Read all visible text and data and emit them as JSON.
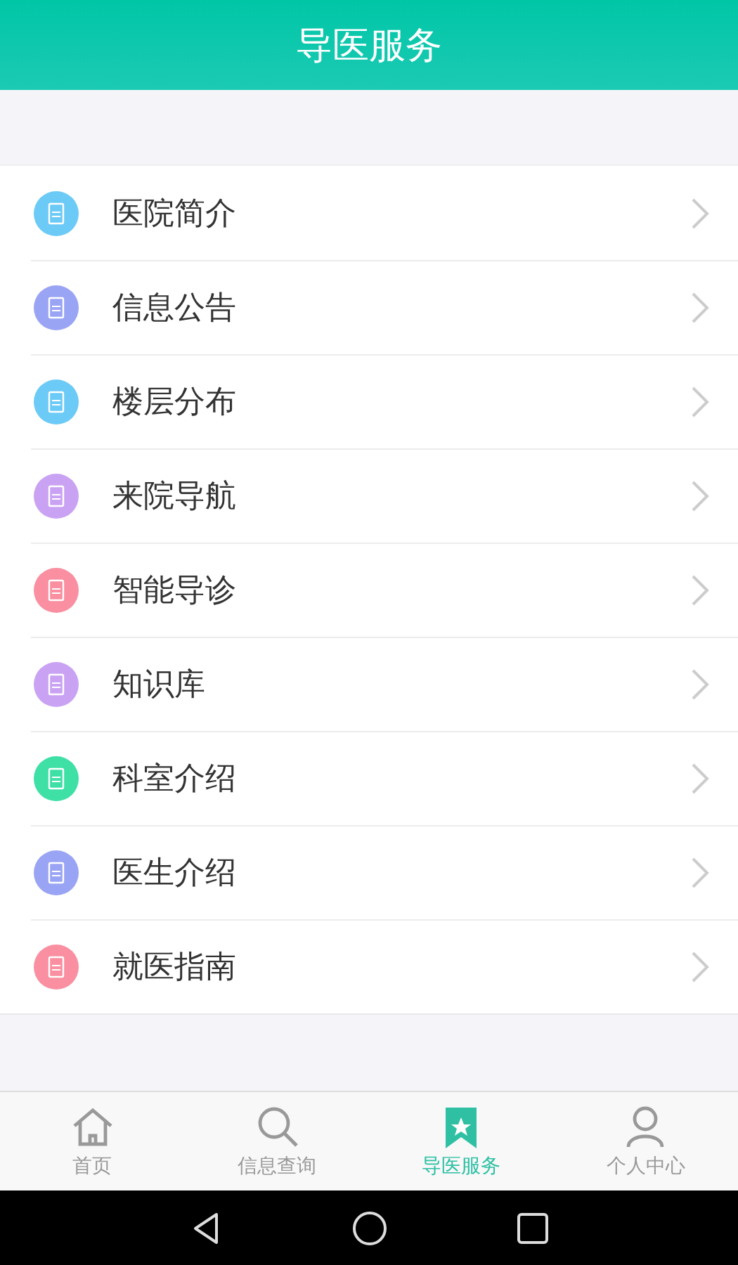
{
  "header": {
    "title": "导医服务"
  },
  "menu": [
    {
      "label": "医院简介",
      "color": "#6ccaf7"
    },
    {
      "label": "信息公告",
      "color": "#9aa4f4"
    },
    {
      "label": "楼层分布",
      "color": "#6ccaf7"
    },
    {
      "label": "来院导航",
      "color": "#caa2f3"
    },
    {
      "label": "智能导诊",
      "color": "#f98fa0"
    },
    {
      "label": "知识库",
      "color": "#caa2f3"
    },
    {
      "label": "科室介绍",
      "color": "#3ee0a6"
    },
    {
      "label": "医生介绍",
      "color": "#9aa4f4"
    },
    {
      "label": "就医指南",
      "color": "#f98fa0"
    }
  ],
  "tabbar": [
    {
      "label": "首页",
      "kind": "home",
      "selected": false
    },
    {
      "label": "信息查询",
      "kind": "search",
      "selected": false
    },
    {
      "label": "导医服务",
      "kind": "bookmark",
      "selected": true
    },
    {
      "label": "个人中心",
      "kind": "person",
      "selected": false
    }
  ]
}
